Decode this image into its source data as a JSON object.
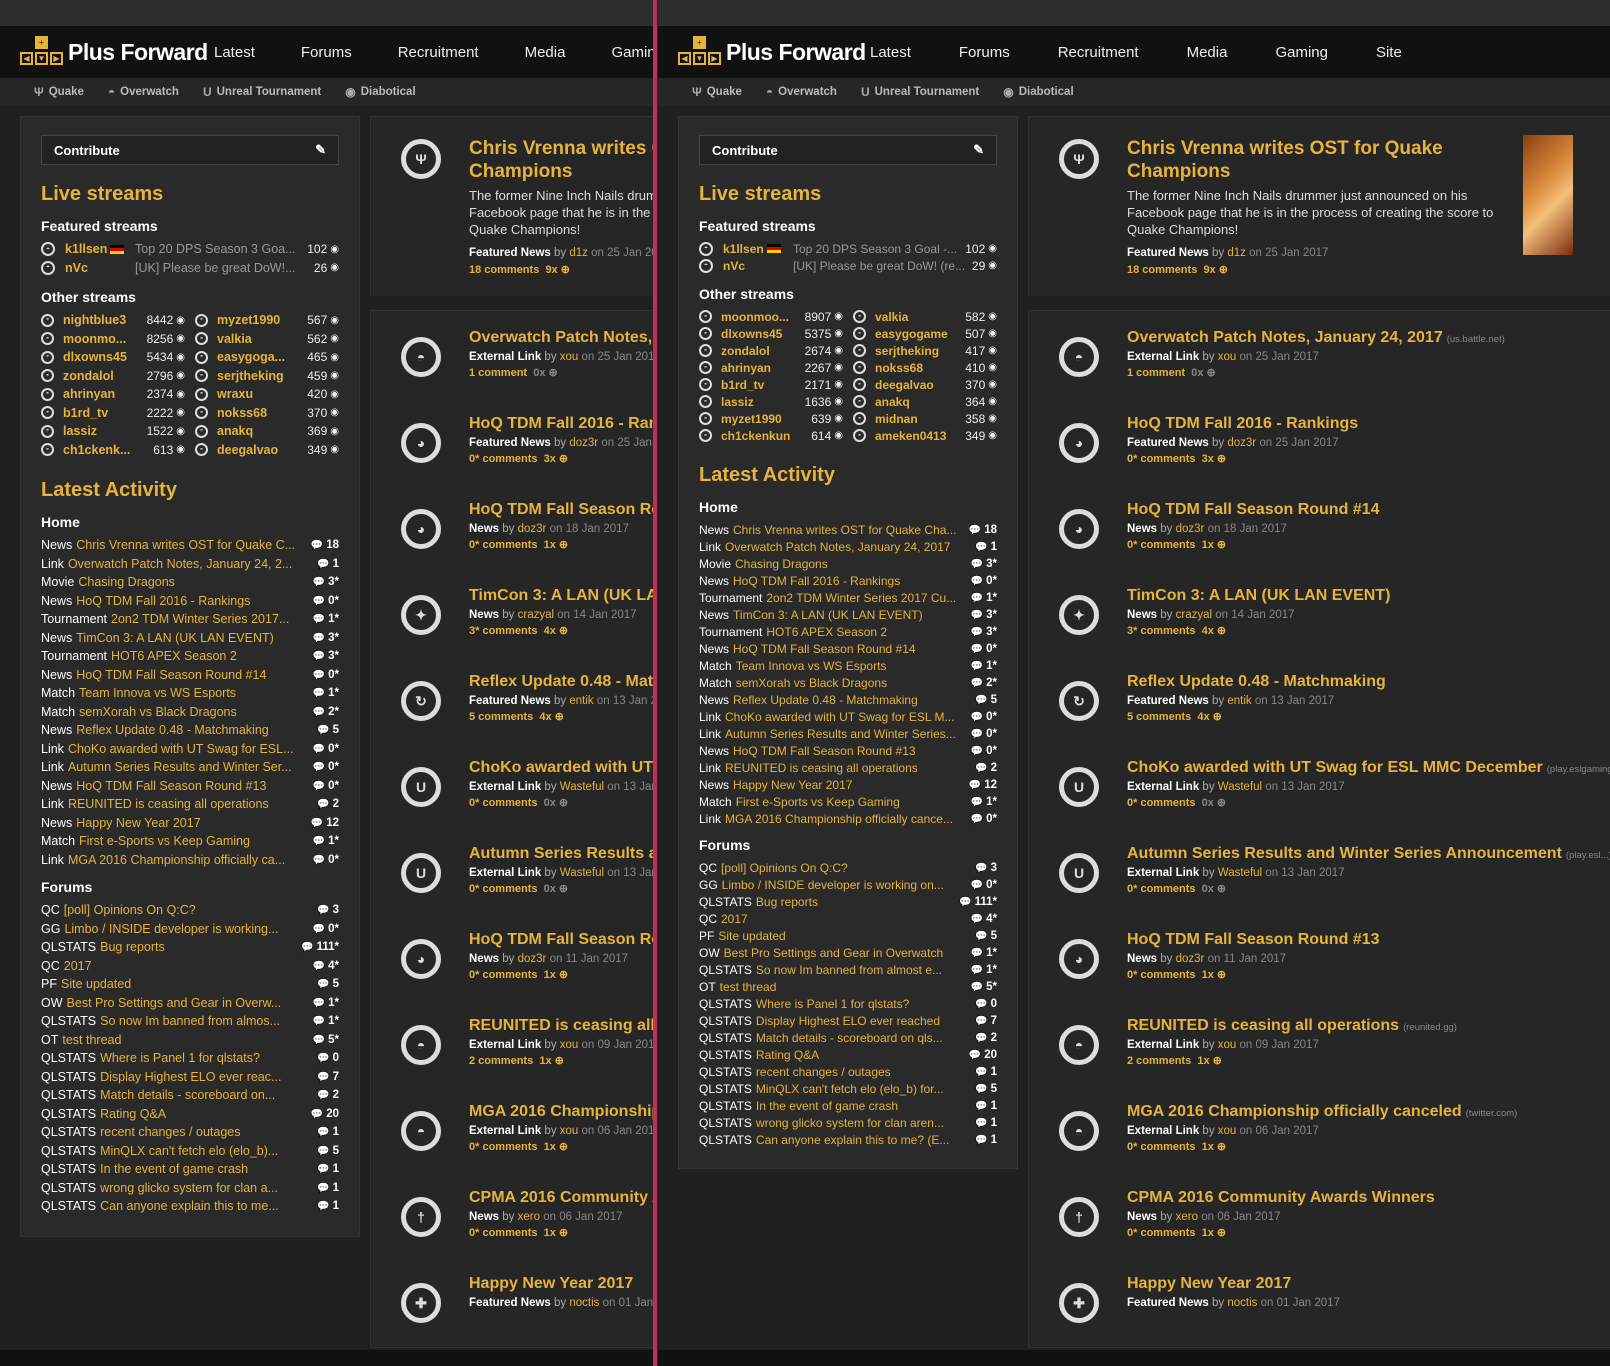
{
  "site": {
    "logo": "Plus Forward"
  },
  "nav": [
    "Latest",
    "Forums",
    "Recruitment",
    "Media",
    "Gaming",
    "Site"
  ],
  "subnav": [
    {
      "label": "Quake",
      "icon": "quake-icon"
    },
    {
      "label": "Overwatch",
      "icon": "overwatch-icon"
    },
    {
      "label": "Unreal Tournament",
      "icon": "unreal-icon"
    },
    {
      "label": "Diabotical",
      "icon": "diabotical-icon"
    }
  ],
  "sidebar": {
    "contribute": "Contribute",
    "live_title": "Live streams",
    "featured_title": "Featured streams",
    "other_title": "Other streams",
    "activity_title": "Latest Activity",
    "home_title": "Home",
    "forums_title": "Forums"
  },
  "left": {
    "featured": [
      {
        "name": "k1llsen",
        "title": "Top 20 DPS Season 3 Goa...",
        "views": "102",
        "flag": true
      },
      {
        "name": "nVc",
        "title": "[UK] Please be great DoW!...",
        "views": "26",
        "flag": false
      }
    ],
    "other": [
      [
        {
          "name": "nightblue3",
          "views": "8442"
        },
        {
          "name": "myzet1990",
          "views": "567"
        }
      ],
      [
        {
          "name": "moonmo...",
          "views": "8256"
        },
        {
          "name": "valkia",
          "views": "562"
        }
      ],
      [
        {
          "name": "dlxowns45",
          "views": "5434"
        },
        {
          "name": "easygoga...",
          "views": "465"
        }
      ],
      [
        {
          "name": "zondalol",
          "views": "2796"
        },
        {
          "name": "serjtheking",
          "views": "459"
        }
      ],
      [
        {
          "name": "ahrinyan",
          "views": "2374"
        },
        {
          "name": "wraxu",
          "views": "420"
        }
      ],
      [
        {
          "name": "b1rd_tv",
          "views": "2222"
        },
        {
          "name": "nokss68",
          "views": "370"
        }
      ],
      [
        {
          "name": "lassiz",
          "views": "1522"
        },
        {
          "name": "anakq",
          "views": "369"
        }
      ],
      [
        {
          "name": "ch1ckenk...",
          "views": "613"
        },
        {
          "name": "deegalvao",
          "views": "349"
        }
      ]
    ],
    "home": [
      {
        "type": "News",
        "title": "Chris Vrenna writes OST for Quake C...",
        "count": "18"
      },
      {
        "type": "Link",
        "title": "Overwatch Patch Notes, January 24, 2...",
        "count": "1"
      },
      {
        "type": "Movie",
        "title": "Chasing Dragons",
        "count": "3*"
      },
      {
        "type": "News",
        "title": "HoQ TDM Fall 2016 - Rankings",
        "count": "0*"
      },
      {
        "type": "Tournament",
        "title": "2on2 TDM Winter Series 2017...",
        "count": "1*"
      },
      {
        "type": "News",
        "title": "TimCon 3: A LAN (UK LAN EVENT)",
        "count": "3*"
      },
      {
        "type": "Tournament",
        "title": "HOT6 APEX Season 2",
        "count": "3*"
      },
      {
        "type": "News",
        "title": "HoQ TDM Fall Season Round #14",
        "count": "0*"
      },
      {
        "type": "Match",
        "title": "Team Innova vs WS Esports",
        "count": "1*"
      },
      {
        "type": "Match",
        "title": "semXorah vs Black Dragons",
        "count": "2*"
      },
      {
        "type": "News",
        "title": "Reflex Update 0.48 - Matchmaking",
        "count": "5"
      },
      {
        "type": "Link",
        "title": "ChoKo awarded with UT Swag for ESL...",
        "count": "0*"
      },
      {
        "type": "Link",
        "title": "Autumn Series Results and Winter Ser...",
        "count": "0*"
      },
      {
        "type": "News",
        "title": "HoQ TDM Fall Season Round #13",
        "count": "0*"
      },
      {
        "type": "Link",
        "title": "REUNITED is ceasing all operations",
        "count": "2"
      },
      {
        "type": "News",
        "title": "Happy New Year 2017",
        "count": "12"
      },
      {
        "type": "Match",
        "title": "First e-Sports vs Keep Gaming",
        "count": "1*"
      },
      {
        "type": "Link",
        "title": "MGA 2016 Championship officially ca...",
        "count": "0*"
      }
    ],
    "forums": [
      {
        "type": "QC",
        "title": "[poll] Opinions On Q:C?",
        "count": "3"
      },
      {
        "type": "GG",
        "title": "Limbo / INSIDE developer is working...",
        "count": "0*"
      },
      {
        "type": "QLSTATS",
        "title": "Bug reports",
        "count": "111*"
      },
      {
        "type": "QC",
        "title": "2017",
        "count": "4*"
      },
      {
        "type": "PF",
        "title": "Site updated",
        "count": "5"
      },
      {
        "type": "OW",
        "title": "Best Pro Settings and Gear in Overw...",
        "count": "1*"
      },
      {
        "type": "QLSTATS",
        "title": "So now Im banned from almos...",
        "count": "1*"
      },
      {
        "type": "OT",
        "title": "test thread",
        "count": "5*"
      },
      {
        "type": "QLSTATS",
        "title": "Where is Panel 1 for qlstats?",
        "count": "0"
      },
      {
        "type": "QLSTATS",
        "title": "Display Highest ELO ever reac...",
        "count": "7"
      },
      {
        "type": "QLSTATS",
        "title": "Match details - scoreboard on...",
        "count": "2"
      },
      {
        "type": "QLSTATS",
        "title": "Rating Q&A",
        "count": "20"
      },
      {
        "type": "QLSTATS",
        "title": "recent changes / outages",
        "count": "1"
      },
      {
        "type": "QLSTATS",
        "title": "MinQLX can't fetch elo (elo_b)...",
        "count": "5"
      },
      {
        "type": "QLSTATS",
        "title": "In the event of game crash",
        "count": "1"
      },
      {
        "type": "QLSTATS",
        "title": "wrong glicko system for clan a...",
        "count": "1"
      },
      {
        "type": "QLSTATS",
        "title": "Can anyone explain this to me...",
        "count": "1"
      }
    ]
  },
  "right": {
    "featured": [
      {
        "name": "k1llsen",
        "title": "Top 20 DPS Season 3 Goal -...",
        "views": "102",
        "flag": true
      },
      {
        "name": "nVc",
        "title": "[UK] Please be great DoW! (re...",
        "views": "29",
        "flag": false
      }
    ],
    "other": [
      [
        {
          "name": "moonmoo...",
          "views": "8907"
        },
        {
          "name": "valkia",
          "views": "582"
        }
      ],
      [
        {
          "name": "dlxowns45",
          "views": "5375"
        },
        {
          "name": "easygogame",
          "views": "507"
        }
      ],
      [
        {
          "name": "zondalol",
          "views": "2674"
        },
        {
          "name": "serjtheking",
          "views": "417"
        }
      ],
      [
        {
          "name": "ahrinyan",
          "views": "2267"
        },
        {
          "name": "nokss68",
          "views": "410"
        }
      ],
      [
        {
          "name": "b1rd_tv",
          "views": "2171"
        },
        {
          "name": "deegalvao",
          "views": "370"
        }
      ],
      [
        {
          "name": "lassiz",
          "views": "1636"
        },
        {
          "name": "anakq",
          "views": "364"
        }
      ],
      [
        {
          "name": "myzet1990",
          "views": "639"
        },
        {
          "name": "midnan",
          "views": "358"
        }
      ],
      [
        {
          "name": "ch1ckenkun",
          "views": "614"
        },
        {
          "name": "ameken0413",
          "views": "349"
        }
      ]
    ],
    "home": [
      {
        "type": "News",
        "title": "Chris Vrenna writes OST for Quake Cha...",
        "count": "18"
      },
      {
        "type": "Link",
        "title": "Overwatch Patch Notes, January 24, 2017",
        "count": "1"
      },
      {
        "type": "Movie",
        "title": "Chasing Dragons",
        "count": "3*"
      },
      {
        "type": "News",
        "title": "HoQ TDM Fall 2016 - Rankings",
        "count": "0*"
      },
      {
        "type": "Tournament",
        "title": "2on2 TDM Winter Series 2017 Cu...",
        "count": "1*"
      },
      {
        "type": "News",
        "title": "TimCon 3: A LAN (UK LAN EVENT)",
        "count": "3*"
      },
      {
        "type": "Tournament",
        "title": "HOT6 APEX Season 2",
        "count": "3*"
      },
      {
        "type": "News",
        "title": "HoQ TDM Fall Season Round #14",
        "count": "0*"
      },
      {
        "type": "Match",
        "title": "Team Innova vs WS Esports",
        "count": "1*"
      },
      {
        "type": "Match",
        "title": "semXorah vs Black Dragons",
        "count": "2*"
      },
      {
        "type": "News",
        "title": "Reflex Update 0.48 - Matchmaking",
        "count": "5"
      },
      {
        "type": "Link",
        "title": "ChoKo awarded with UT Swag for ESL M...",
        "count": "0*"
      },
      {
        "type": "Link",
        "title": "Autumn Series Results and Winter Series...",
        "count": "0*"
      },
      {
        "type": "News",
        "title": "HoQ TDM Fall Season Round #13",
        "count": "0*"
      },
      {
        "type": "Link",
        "title": "REUNITED is ceasing all operations",
        "count": "2"
      },
      {
        "type": "News",
        "title": "Happy New Year 2017",
        "count": "12"
      },
      {
        "type": "Match",
        "title": "First e-Sports vs Keep Gaming",
        "count": "1*"
      },
      {
        "type": "Link",
        "title": "MGA 2016 Championship officially cance...",
        "count": "0*"
      }
    ],
    "forums": [
      {
        "type": "QC",
        "title": "[poll] Opinions On Q:C?",
        "count": "3"
      },
      {
        "type": "GG",
        "title": "Limbo / INSIDE developer is working on...",
        "count": "0*"
      },
      {
        "type": "QLSTATS",
        "title": "Bug reports",
        "count": "111*"
      },
      {
        "type": "QC",
        "title": "2017",
        "count": "4*"
      },
      {
        "type": "PF",
        "title": "Site updated",
        "count": "5"
      },
      {
        "type": "OW",
        "title": "Best Pro Settings and Gear in Overwatch",
        "count": "1*"
      },
      {
        "type": "QLSTATS",
        "title": "So now Im banned from almost e...",
        "count": "1*"
      },
      {
        "type": "OT",
        "title": "test thread",
        "count": "5*"
      },
      {
        "type": "QLSTATS",
        "title": "Where is Panel 1 for qlstats?",
        "count": "0"
      },
      {
        "type": "QLSTATS",
        "title": "Display Highest ELO ever reached",
        "count": "7"
      },
      {
        "type": "QLSTATS",
        "title": "Match details - scoreboard on qls...",
        "count": "2"
      },
      {
        "type": "QLSTATS",
        "title": "Rating Q&A",
        "count": "20"
      },
      {
        "type": "QLSTATS",
        "title": "recent changes / outages",
        "count": "1"
      },
      {
        "type": "QLSTATS",
        "title": "MinQLX can't fetch elo (elo_b) for...",
        "count": "5"
      },
      {
        "type": "QLSTATS",
        "title": "In the event of game crash",
        "count": "1"
      },
      {
        "type": "QLSTATS",
        "title": "wrong glicko system for clan aren...",
        "count": "1"
      },
      {
        "type": "QLSTATS",
        "title": "Can anyone explain this to me? (E...",
        "count": "1"
      }
    ]
  },
  "feed": {
    "lead": {
      "title": "Chris Vrenna writes OST for Quake Champions",
      "desc": "The former Nine Inch Nails drummer just announced on his Facebook page that he is in the process of creating the score to Quake Champions!",
      "type": "Featured News",
      "author": "d1z",
      "date": "25 Jan 2017",
      "comments": "18 comments",
      "plus": "9x",
      "icon": "quake-icon"
    },
    "items": [
      {
        "title": "Overwatch Patch Notes, January 24, 2017",
        "source": "(us.battle.net)",
        "type": "External Link",
        "author": "xou",
        "date": "25 Jan 2017",
        "comments": "1 comment",
        "plus": "0x",
        "icon": "overwatch-icon"
      },
      {
        "title": "HoQ TDM Fall 2016 - Rankings",
        "source": "",
        "type": "Featured News",
        "author": "doz3r",
        "date": "25 Jan 2017",
        "comments": "0* comments",
        "plus": "3x",
        "icon": "hoq-icon"
      },
      {
        "title": "HoQ TDM Fall Season Round #14",
        "source": "",
        "type": "News",
        "author": "doz3r",
        "date": "18 Jan 2017",
        "comments": "0* comments",
        "plus": "1x",
        "icon": "hoq-icon"
      },
      {
        "title": "TimCon 3: A LAN (UK LAN EVENT)",
        "source": "",
        "type": "News",
        "author": "crazyal",
        "date": "14 Jan 2017",
        "comments": "3* comments",
        "plus": "4x",
        "icon": "multi-game-icon"
      },
      {
        "title": "Reflex Update 0.48 - Matchmaking",
        "source": "",
        "type": "Featured News",
        "author": "entik",
        "date": "13 Jan 2017",
        "comments": "5 comments",
        "plus": "4x",
        "icon": "reflex-icon"
      },
      {
        "title": "ChoKo awarded with UT Swag for ESL MMC December",
        "source": "(play.eslgaming.com)",
        "type": "External Link",
        "author": "Wasteful",
        "date": "13 Jan 2017",
        "comments": "0* comments",
        "plus": "0x",
        "icon": "unreal-icon"
      },
      {
        "title": "Autumn Series Results and Winter Series Announcement",
        "source": "(play.esl...)",
        "type": "External Link",
        "author": "Wasteful",
        "date": "13 Jan 2017",
        "comments": "0* comments",
        "plus": "0x",
        "icon": "unreal-icon"
      },
      {
        "title": "HoQ TDM Fall Season Round #13",
        "source": "",
        "type": "News",
        "author": "doz3r",
        "date": "11 Jan 2017",
        "comments": "0* comments",
        "plus": "1x",
        "icon": "hoq-icon"
      },
      {
        "title": "REUNITED is ceasing all operations",
        "source": "(reunited.gg)",
        "type": "External Link",
        "author": "xou",
        "date": "09 Jan 2017",
        "comments": "2 comments",
        "plus": "1x",
        "icon": "overwatch-icon"
      },
      {
        "title": "MGA 2016 Championship officially canceled",
        "source": "(twitter.com)",
        "type": "External Link",
        "author": "xou",
        "date": "06 Jan 2017",
        "comments": "0* comments",
        "plus": "1x",
        "icon": "overwatch-icon"
      },
      {
        "title": "CPMA 2016 Community Awards Winners",
        "source": "",
        "type": "News",
        "author": "xero",
        "date": "06 Jan 2017",
        "comments": "0* comments",
        "plus": "1x",
        "icon": "cpma-icon"
      },
      {
        "title": "Happy New Year 2017",
        "source": "",
        "type": "Featured News",
        "author": "noctis",
        "date": "01 Jan 2017",
        "comments": "",
        "plus": "",
        "icon": "plusforward-icon"
      }
    ]
  },
  "labels": {
    "by": "by",
    "on": "on"
  },
  "colors": {
    "accent": "#e6b33d",
    "divider": "#c2305a",
    "background": "#202020",
    "card": "#2a2a2a"
  }
}
